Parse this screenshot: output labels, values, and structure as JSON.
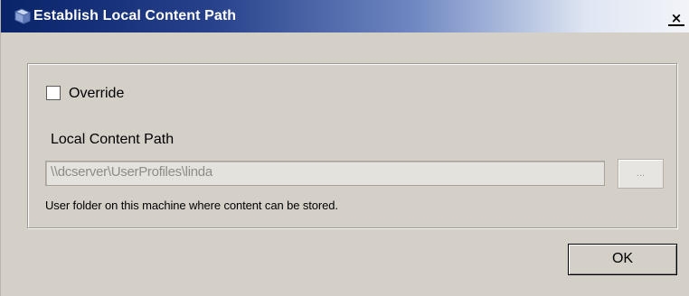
{
  "window": {
    "title": "Establish Local Content Path",
    "close_glyph": "×",
    "icon": "app-window-icon"
  },
  "override": {
    "label": "Override",
    "checked": false
  },
  "local_content_path": {
    "label": "Local Content Path",
    "value": "\\\\dcserver\\UserProfiles\\linda",
    "disabled": true,
    "browse_label": "...",
    "hint": "User folder on this machine where content can be stored."
  },
  "footer": {
    "ok_label": "OK"
  },
  "colors": {
    "titlebar_start": "#0a246a",
    "titlebar_end": "#f2f4f8",
    "dialog_bg": "#d4d0c8",
    "disabled_text": "#8e8c87"
  }
}
